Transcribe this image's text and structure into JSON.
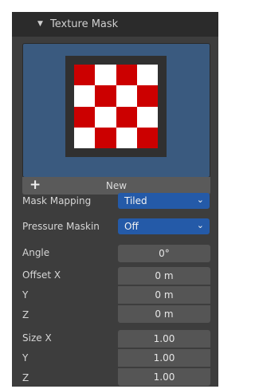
{
  "panel": {
    "title": "Texture Mask"
  },
  "texture": {
    "new_label": "New"
  },
  "mask_mapping": {
    "label": "Mask Mapping",
    "value": "Tiled"
  },
  "pressure_masking": {
    "label": "Pressure Maskin",
    "value": "Off"
  },
  "angle": {
    "label": "Angle",
    "value": "0°"
  },
  "offset": {
    "x_label": "Offset X",
    "y_label": "Y",
    "z_label": "Z",
    "x": "0 m",
    "y": "0 m",
    "z": "0 m"
  },
  "size": {
    "x_label": "Size X",
    "y_label": "Y",
    "z_label": "Z",
    "x": "1.00",
    "y": "1.00",
    "z": "1.00"
  },
  "colors": {
    "panel_bg": "#3d3d3d",
    "header_bg": "#2b2b2b",
    "accent": "#245aa8",
    "preview_bg": "#3a5a7f",
    "checker_red": "#cc0000"
  },
  "icons": {
    "collapse": "triangle-down-icon",
    "add": "plus-icon",
    "dropdown": "chevron-down-icon"
  }
}
